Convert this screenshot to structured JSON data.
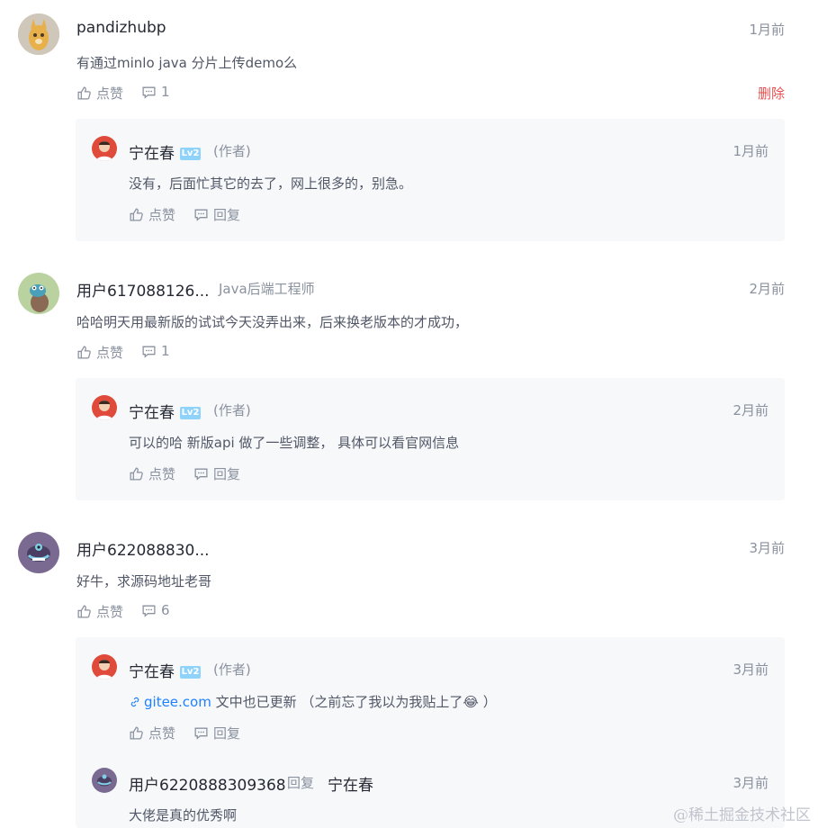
{
  "comments": [
    {
      "user": "pandizhubp",
      "title": "",
      "time": "1月前",
      "text": "有通过minlo java 分片上传demo么",
      "like_label": "点赞",
      "reply_count": "1",
      "delete_label": "删除",
      "replies": [
        {
          "user": "宁在春",
          "level": "Lv2",
          "author_tag": "(作者)",
          "time": "1月前",
          "text": "没有，后面忙其它的去了，网上很多的，别急。",
          "like_label": "点赞",
          "reply_label": "回复"
        }
      ]
    },
    {
      "user": "用户617088126...",
      "title": "Java后端工程师",
      "time": "2月前",
      "text": "哈哈明天用最新版的试试今天没弄出来，后来换老版本的才成功，",
      "like_label": "点赞",
      "reply_count": "1",
      "replies": [
        {
          "user": "宁在春",
          "level": "Lv2",
          "author_tag": "(作者)",
          "time": "2月前",
          "text": "可以的哈 新版api 做了一些调整，  具体可以看官网信息",
          "like_label": "点赞",
          "reply_label": "回复"
        }
      ]
    },
    {
      "user": "用户622088830...",
      "title": "",
      "time": "3月前",
      "text": "好牛，求源码地址老哥",
      "like_label": "点赞",
      "reply_count": "6",
      "replies": [
        {
          "user": "宁在春",
          "level": "Lv2",
          "author_tag": "(作者)",
          "time": "3月前",
          "link_text": "gitee.com",
          "text": " 文中也已更新  （之前忘了我以为我贴上了",
          "emoji": "😂",
          "text_end": " ）",
          "like_label": "点赞",
          "reply_label": "回复"
        },
        {
          "user": "用户6220888309368",
          "reply_word": "回复",
          "reply_to": "宁在春",
          "time": "3月前",
          "text": "大佬是真的优秀啊"
        }
      ]
    }
  ],
  "watermark": "@稀土掘金技术社区",
  "colors": {
    "accent": "#1e80ff",
    "delete": "#e55050",
    "reply_bg": "#f7f8fa",
    "muted": "#8a919f"
  }
}
